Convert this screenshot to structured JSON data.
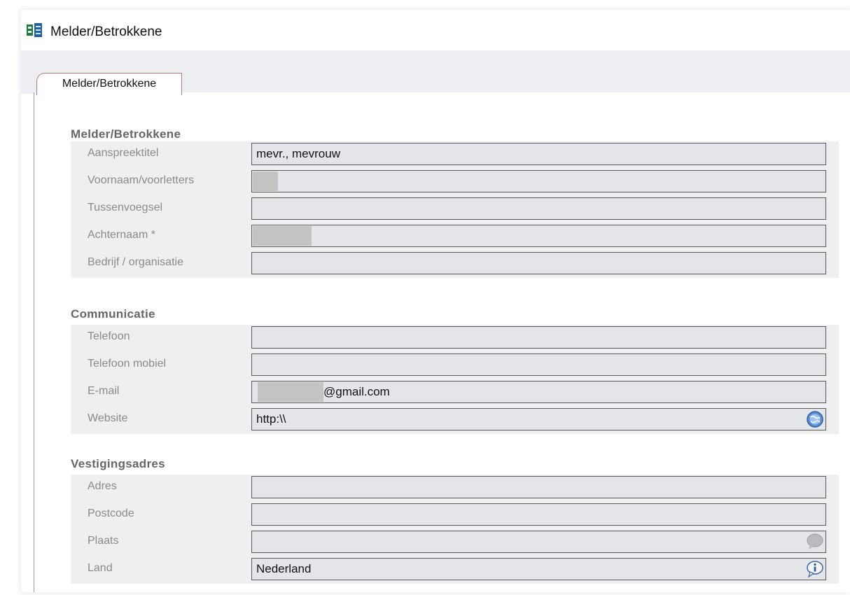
{
  "window": {
    "title": "Melder/Betrokkene"
  },
  "tabs": [
    {
      "label": "Melder/Betrokkene",
      "active": true
    }
  ],
  "sections": {
    "melder": {
      "title": "Melder/Betrokkene",
      "fields": {
        "aanspreektitel": {
          "label": "Aanspreektitel",
          "value": "mevr., mevrouw"
        },
        "voornaam": {
          "label": "Voornaam/voorletters",
          "value": ""
        },
        "tussenvoegsel": {
          "label": "Tussenvoegsel",
          "value": ""
        },
        "achternaam": {
          "label": "Achternaam *",
          "value": ""
        },
        "bedrijf": {
          "label": "Bedrijf / organisatie",
          "value": ""
        }
      }
    },
    "communicatie": {
      "title": "Communicatie",
      "fields": {
        "telefoon": {
          "label": "Telefoon",
          "value": ""
        },
        "mobiel": {
          "label": "Telefoon mobiel",
          "value": ""
        },
        "email": {
          "label": "E-mail",
          "value": "@gmail.com"
        },
        "website": {
          "label": "Website",
          "value": "http:\\\\",
          "icon": "globe-icon"
        }
      }
    },
    "adres": {
      "title": "Vestigingsadres",
      "fields": {
        "adres": {
          "label": "Adres",
          "value": ""
        },
        "postcode": {
          "label": "Postcode",
          "value": ""
        },
        "plaats": {
          "label": "Plaats",
          "value": "",
          "icon": "speech-bubble-icon"
        },
        "land": {
          "label": "Land",
          "value": "Nederland",
          "icon": "info-icon"
        }
      }
    }
  },
  "colors": {
    "tab_border": "#c8727a",
    "section_title": "#666666",
    "label": "#8a8a8a",
    "group_bg": "#eeeff1",
    "field_bg": "#e4e5e8"
  }
}
